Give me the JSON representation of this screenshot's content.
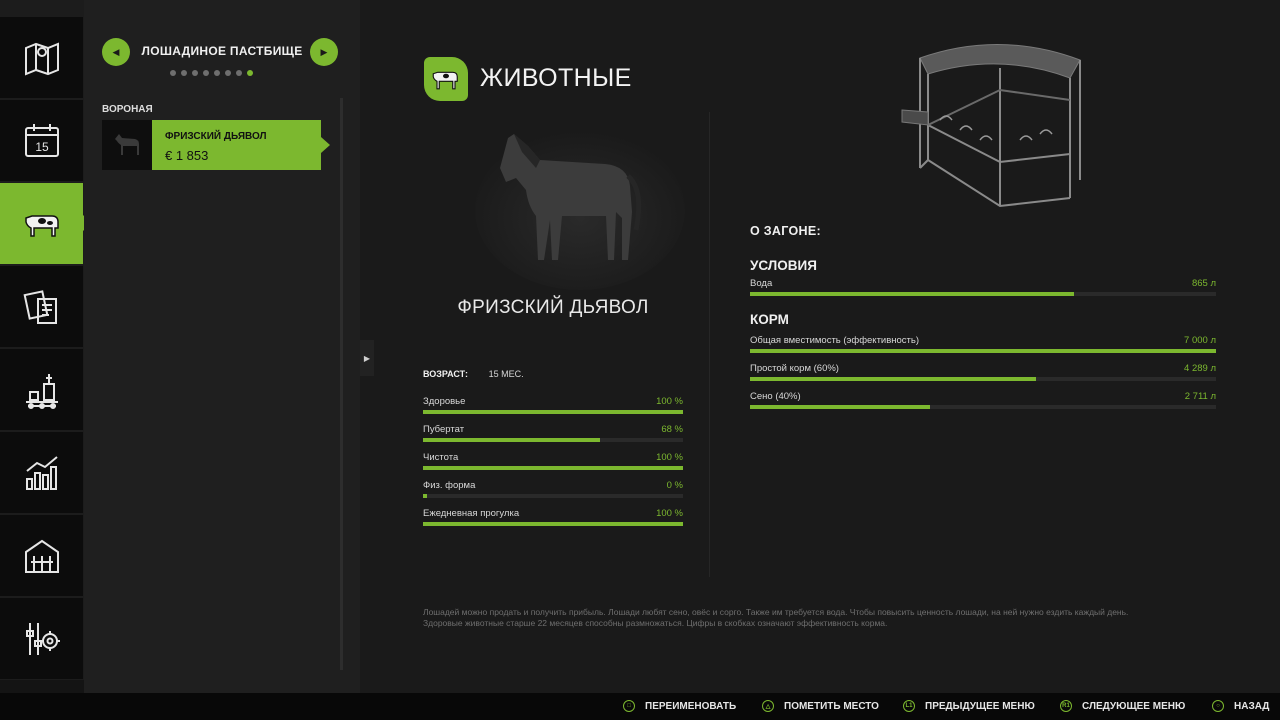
{
  "sidebar": {
    "items": [
      {
        "icon": "map-icon"
      },
      {
        "icon": "calendar-icon",
        "text": "15"
      },
      {
        "icon": "cow-icon",
        "active": true
      },
      {
        "icon": "contracts-icon"
      },
      {
        "icon": "production-icon"
      },
      {
        "icon": "statistics-icon"
      },
      {
        "icon": "barn-icon"
      },
      {
        "icon": "settings-icon"
      }
    ]
  },
  "pasture": {
    "title": "ЛОШАДИНОЕ ПАСТБИЩЕ",
    "page_count": 8,
    "active_page": 8
  },
  "group_label": "ВОРОНАЯ",
  "animal_card": {
    "name": "ФРИЗСКИЙ ДЬЯВОЛ",
    "price": "€ 1 853"
  },
  "section": {
    "title": "ЖИВОТНЫЕ"
  },
  "animal": {
    "name": "ФРИЗСКИЙ ДЬЯВОЛ",
    "age_label": "ВОЗРАСТ:",
    "age_value": "15 МЕС.",
    "stats": [
      {
        "label": "Здоровье",
        "value": "100 %",
        "fraction": 1.0
      },
      {
        "label": "Пубертат",
        "value": "68 %",
        "fraction": 0.68
      },
      {
        "label": "Чистота",
        "value": "100 %",
        "fraction": 1.0
      },
      {
        "label": "Физ. форма",
        "value": "0 %",
        "fraction": 0.015
      },
      {
        "label": "Ежедневная прогулка",
        "value": "100 %",
        "fraction": 1.0
      }
    ]
  },
  "pen": {
    "title": "О ЗАГОНЕ:",
    "conditions_title": "УСЛОВИЯ",
    "conditions": [
      {
        "label": "Вода",
        "value": "865 л",
        "fraction": 0.696
      }
    ],
    "feed_title": "КОРМ",
    "feed": [
      {
        "label": "Общая вместимость (эффективность)",
        "value": "7 000 л",
        "fraction": 1.0
      },
      {
        "label": "Простой корм (60%)",
        "value": "4 289 л",
        "fraction": 0.613
      },
      {
        "label": "Сено (40%)",
        "value": "2 711 л",
        "fraction": 0.387
      }
    ]
  },
  "footnote": "Лошадей можно продать и получить прибыль. Лошади любят сено, овёс и сорго. Также им требуется вода. Чтобы повысить ценность лошади, на ней нужно ездить каждый день. Здоровые животные старше 22 месяцев способны размножаться. Цифры в скобках означают эффективность корма.",
  "bottom_hints": [
    {
      "key": "□",
      "label": "ПЕРЕИМЕНОВАТЬ"
    },
    {
      "key": "△",
      "label": "ПОМЕТИТЬ МЕСТО"
    },
    {
      "key": "L1",
      "label": "ПРЕДЫДУЩЕЕ МЕНЮ"
    },
    {
      "key": "R1",
      "label": "СЛЕДУЮЩЕЕ МЕНЮ"
    },
    {
      "key": "○",
      "label": "НАЗАД"
    }
  ],
  "colors": {
    "accent": "#7cb82f",
    "background": "#1a1a1a",
    "panel": "#1f1f1f"
  }
}
